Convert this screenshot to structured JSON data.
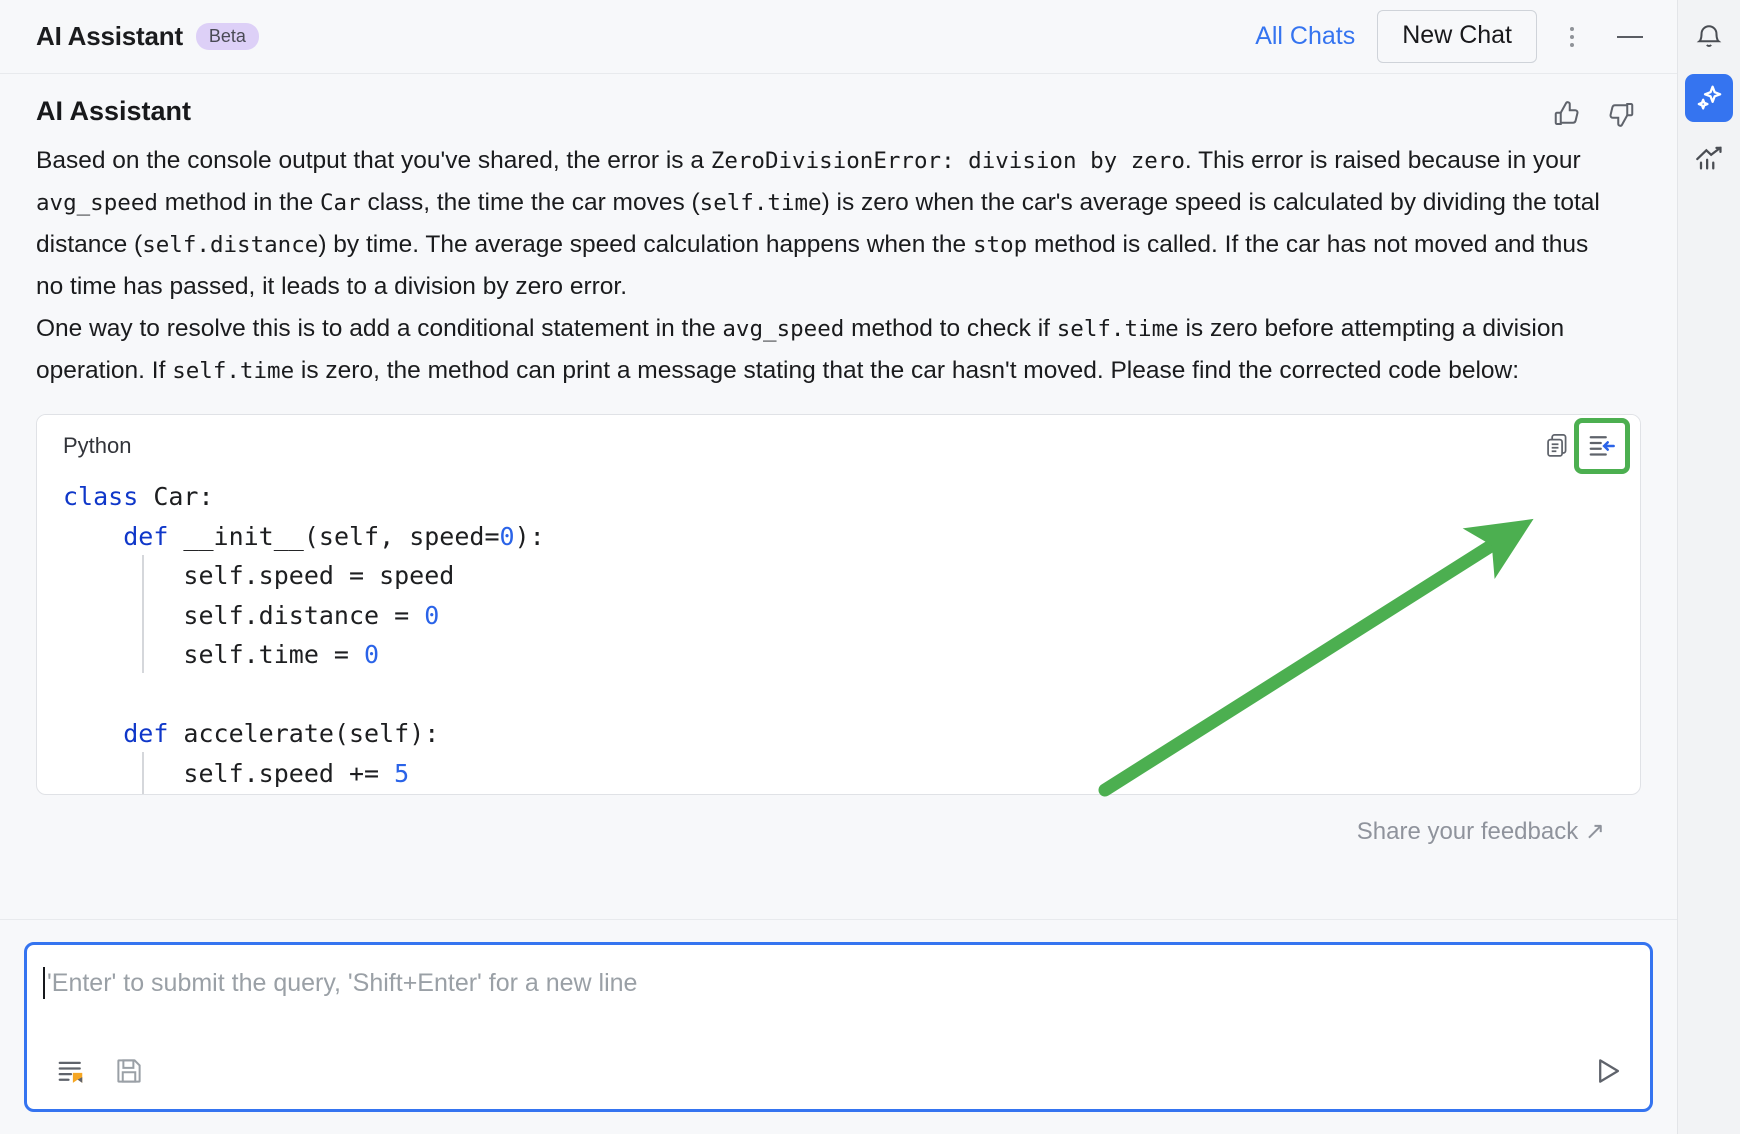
{
  "header": {
    "title": "AI Assistant",
    "badge": "Beta",
    "all_chats": "All Chats",
    "new_chat": "New Chat",
    "more_icon": "kebab-menu-icon",
    "minimize_icon": "minimize-icon"
  },
  "message": {
    "author": "AI Assistant",
    "thumbs_up_icon": "thumbs-up-icon",
    "thumbs_down_icon": "thumbs-down-icon",
    "paragraph1_parts": [
      {
        "t": "Based on the console output that you've shared, the error is a ",
        "code": false
      },
      {
        "t": "ZeroDivisionError: division by zero",
        "code": true
      },
      {
        "t": ". This error is raised because in your ",
        "code": false
      },
      {
        "t": "avg_speed",
        "code": true
      },
      {
        "t": " method in the ",
        "code": false
      },
      {
        "t": "Car",
        "code": true
      },
      {
        "t": " class, the time the car moves (",
        "code": false
      },
      {
        "t": "self.time",
        "code": true
      },
      {
        "t": ") is zero when the car's average speed is calculated by dividing the total distance (",
        "code": false
      },
      {
        "t": "self.distance",
        "code": true
      },
      {
        "t": ") by time. The average speed calculation happens when the ",
        "code": false
      },
      {
        "t": "stop",
        "code": true
      },
      {
        "t": " method is called. If the car has not moved and thus no time has passed, it leads to a division by zero error.",
        "code": false
      }
    ],
    "paragraph2_parts": [
      {
        "t": "One way to resolve this is to add a conditional statement in the ",
        "code": false
      },
      {
        "t": "avg_speed",
        "code": true
      },
      {
        "t": " method to check if ",
        "code": false
      },
      {
        "t": "self.time",
        "code": true
      },
      {
        "t": " is zero before attempting a division operation. If ",
        "code": false
      },
      {
        "t": "self.time",
        "code": true
      },
      {
        "t": " is zero, the method can print a message stating that the car hasn't moved. Please find the corrected code below:",
        "code": false
      }
    ]
  },
  "code_block": {
    "language": "Python",
    "copy_icon": "copy-icon",
    "insert_icon": "insert-into-editor-icon",
    "lines": [
      [
        {
          "t": "class",
          "c": "kw"
        },
        {
          "t": " Car:",
          "c": ""
        }
      ],
      [
        {
          "t": "    ",
          "c": ""
        },
        {
          "t": "def",
          "c": "kw"
        },
        {
          "t": " __init__(self, speed=",
          "c": ""
        },
        {
          "t": "0",
          "c": "num"
        },
        {
          "t": "):",
          "c": ""
        }
      ],
      [
        {
          "t": "        self.speed = speed",
          "c": ""
        }
      ],
      [
        {
          "t": "        self.distance = ",
          "c": ""
        },
        {
          "t": "0",
          "c": "num"
        }
      ],
      [
        {
          "t": "        self.time = ",
          "c": ""
        },
        {
          "t": "0",
          "c": "num"
        }
      ],
      [
        {
          "t": "",
          "c": ""
        }
      ],
      [
        {
          "t": "    ",
          "c": ""
        },
        {
          "t": "def",
          "c": "kw"
        },
        {
          "t": " accelerate(self):",
          "c": ""
        }
      ],
      [
        {
          "t": "        self.speed += ",
          "c": ""
        },
        {
          "t": "5",
          "c": "num"
        }
      ]
    ]
  },
  "feedback": {
    "label": "Share your feedback ↗"
  },
  "input": {
    "placeholder": "'Enter' to submit the query, 'Shift+Enter' for a new line",
    "value": "",
    "context_icon": "add-context-file-icon",
    "save_icon": "save-icon",
    "send_icon": "send-icon"
  },
  "rail": {
    "items": [
      {
        "icon": "notifications-bell-icon",
        "active": false
      },
      {
        "icon": "ai-assistant-sparkle-icon",
        "active": true
      },
      {
        "icon": "analytics-chart-icon",
        "active": false
      }
    ]
  },
  "annotation": {
    "arrow_color": "#4caf50",
    "highlight_color": "#4caf50",
    "arrow_from": "1105,790",
    "arrow_to": "1520,530"
  },
  "colors": {
    "accent_blue": "#3574f0",
    "link_blue": "#3574f0",
    "badge_purple": "#ddd0f7",
    "code_keyword": "#0f37c9",
    "code_number": "#2a63e8"
  }
}
